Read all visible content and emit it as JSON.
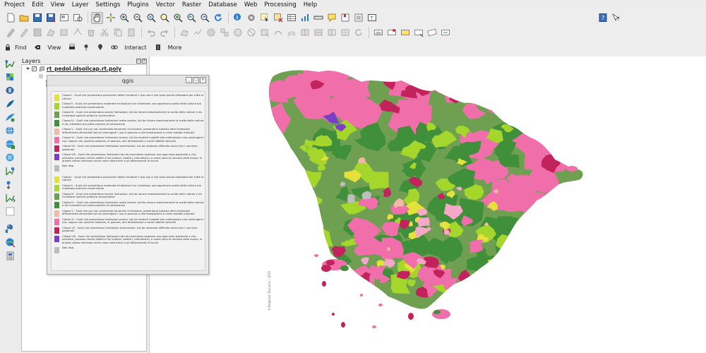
{
  "menubar": {
    "items": [
      "Project",
      "Edit",
      "View",
      "Layer",
      "Settings",
      "Plugins",
      "Vector",
      "Raster",
      "Database",
      "Web",
      "Processing",
      "Help"
    ]
  },
  "toolbar1": {
    "icons": [
      "new-project-icon",
      "open-project-icon",
      "save-project-icon",
      "save-as-icon",
      "new-print-layout-icon",
      "layout-manager-icon",
      "pan-icon",
      "pan-to-selection-icon",
      "zoom-in-icon",
      "zoom-out-icon",
      "zoom-full-icon",
      "zoom-to-selection-icon",
      "zoom-to-layer-icon",
      "zoom-last-icon",
      "zoom-next-icon",
      "refresh-icon",
      "identify-icon",
      "run-feature-action-icon",
      "select-features-icon",
      "deselect-icon",
      "open-attribute-table-icon",
      "statistics-icon",
      "measure-icon",
      "map-tips-icon",
      "new-bookmark-icon",
      "show-bookmarks-icon",
      "text-annotation-icon",
      "help-icon",
      "whats-this-icon"
    ]
  },
  "toolbar2": {
    "icons": [
      "current-edits-icon",
      "toggle-editing-icon",
      "save-edits-icon",
      "add-feature-icon",
      "move-feature-icon",
      "node-tool-icon",
      "delete-selected-icon",
      "cut-features-icon",
      "copy-features-icon",
      "paste-features-icon",
      "undo-icon",
      "redo-icon",
      "digitize-icon",
      "simplify-icon",
      "add-ring-icon",
      "add-part-icon",
      "fill-ring-icon",
      "delete-ring-icon",
      "delete-part-icon",
      "reshape-icon",
      "offset-curve-icon",
      "split-features-icon",
      "split-parts-icon",
      "merge-features-icon",
      "merge-attributes-icon",
      "rotate-symbols-icon",
      "label-icon",
      "pin-labels-icon",
      "highlight-labels-icon",
      "move-label-icon",
      "rotate-label-icon",
      "change-label-icon"
    ]
  },
  "toolbar3": {
    "find_label": "Find",
    "view_label": "View",
    "interact_label": "Interact",
    "more_label": "More"
  },
  "sidebar_tools": [
    "add-vector-layer-icon",
    "add-raster-layer-icon",
    "add-postgis-icon",
    "add-spatialite-icon",
    "add-wms-icon",
    "add-wcs-icon",
    "add-wfs-icon",
    "add-delimited-text-icon",
    "add-oracle-icon",
    "new-layer-icon",
    "new-shapefile-icon",
    "python-console-icon",
    "georeferencer-icon",
    "plugin-icon"
  ],
  "layers_panel": {
    "title": "Layers",
    "layer_name": "rt_pedol.idsoilcap.rt.poly"
  },
  "dialog": {
    "title": "qgis",
    "legend_group1": [
      {
        "color": "#e4e13a",
        "text": "Classe I - Suoli che presentano pochissimi fattori limitanti il loro uso e che sono quindi utilizzabili per tutte le colture"
      },
      {
        "color": "#a4d62c",
        "text": "Classe II - Suoli che presentano moderate limitazioni che richiedono una opportuna scelta delle colture e/o moderate pratiche conservative"
      },
      {
        "color": "#6fa052",
        "text": "Classe III - Suoli che presentano severe limitazioni, tali da ridurre drasticamente la scelta delle colture e da richiedere speciali pratiche conservative"
      },
      {
        "color": "#3f8f3b",
        "text": "Classe IV - Suoli che presentano limitazioni molto severe, tali da ridurre drasticamente la scelta delle colture e da richiedere accurate pratiche di coltivazione"
      },
      {
        "color": "#f2b8a8",
        "text": "Classe V - Suoli che pur non mostrando fenomeni di erosione, presentano tuttavia altre limitazioni difficilmente eliminabili tali da restringere l uso al pascolo o alla forestazione o come habitat naturale"
      },
      {
        "color": "#f06ea9",
        "text": "Classe VI - Suoli che presentano limitazioni severe, tali da renderli inadatti alla coltivazione e da restringere l uso, seppur con qualche ostacolo, al pascolo, alla forestazione o come habitat naturale"
      },
      {
        "color": "#c2235b",
        "text": "Classe VII - Suoli che presentano limitazioni severissime, tali da mostrare difficolta anche per l uso silvo pastorale"
      },
      {
        "color": "#7a3ec7",
        "text": "Classe VIII - Suoli che presentano limitazioni tali da precludere qualsiasi uso agro-silvo-pastorale e che, pertanto, possono venire adibiti a fini creativi, estetici, naturalistici, o come zona di raccolta delle acque. In questa classe rientrano anche zone calanchive e gli affioramenti di roccia"
      },
      {
        "color": "#bdbdbd",
        "text": "Non disp."
      }
    ],
    "legend_group2": [
      {
        "color": "#e4e13a",
        "text": "Classe I - Suoli che presentano pochissimi fattori limitanti il loro uso e che sono quindi utilizzabili per tutte le colture"
      },
      {
        "color": "#a4d62c",
        "text": "Classe II - Suoli che presentano moderate limitazioni che richiedono una opportuna scelta delle colture e/o moderate pratiche conservative"
      },
      {
        "color": "#6fa052",
        "text": "Classe III - Suoli che presentano severe limitazioni, tali da ridurre drasticamente la scelta delle colture e da richiedere speciali pratiche conservative"
      },
      {
        "color": "#3f8f3b",
        "text": "Classe IV - Suoli che presentano limitazioni molto severe, tali da ridurre drasticamente la scelta delle colture e da richiedere accurate pratiche di coltivazione"
      },
      {
        "color": "#f2b8a8",
        "text": "Classe V - Suoli che pur non mostrando fenomeni di erosione, presentano tuttavia altre limitazioni difficilmente eliminabili tali da restringere l uso al pascolo o alla forestazione o come habitat naturale"
      },
      {
        "color": "#f06ea9",
        "text": "Classe VI - Suoli che presentano limitazioni severe, tali da renderli inadatti alla coltivazione e da restringere l uso, seppur con qualche ostacolo, al pascolo, alla forestazione o come habitat naturale"
      },
      {
        "color": "#c2235b",
        "text": "Classe VII - Suoli che presentano limitazioni severissime, tali da mostrare difficolta anche per l uso silvo pastorale"
      },
      {
        "color": "#7a3ec7",
        "text": "Classe VIII - Suoli che presentano limitazioni tali da precludere qualsiasi uso agro-silvo-pastorale e che, pertanto, possono venire adibiti a fini creativi, estetici, naturalistici, o come zona di raccolta delle acque. In questa classe rientrano anche zone calanchive e gli affioramenti di roccia"
      },
      {
        "color": "#bdbdbd",
        "text": "Non disp."
      }
    ]
  },
  "map": {
    "credit": "©Regione Toscana - SITA",
    "colors": {
      "pink": "#f06ea9",
      "light_pink": "#f5a8c8",
      "crimson": "#c2235b",
      "dark_green": "#3f8f3b",
      "mid_green": "#6fa052",
      "lime": "#a4d62c",
      "yellow": "#e4e13a",
      "purple": "#7a3ec7",
      "salmon": "#f2b8a8",
      "grey": "#bdbdbd"
    }
  }
}
